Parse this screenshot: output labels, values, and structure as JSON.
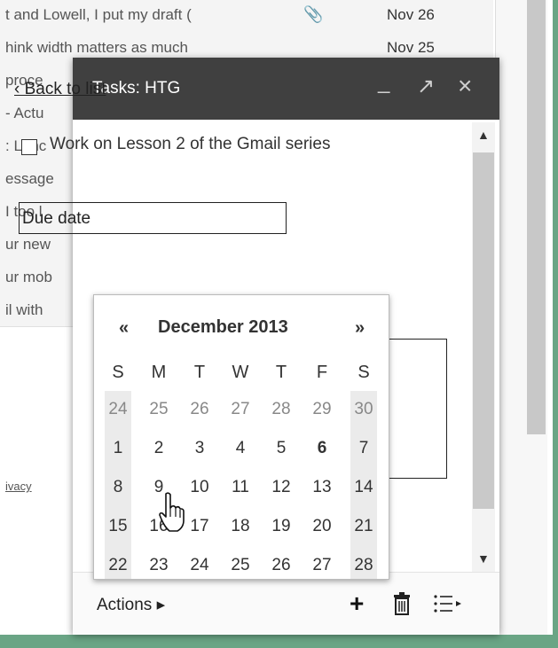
{
  "background": {
    "rows": [
      {
        "snippet": "t and Lowell, I put my draft (",
        "date": "Nov 26",
        "attachment": true
      },
      {
        "snippet": "hink width matters as much",
        "date": "Nov 25",
        "attachment": false
      },
      {
        "snippet": "proce",
        "date": "",
        "attachment": false
      },
      {
        "snippet": "- Actu",
        "date": "",
        "attachment": false
      },
      {
        "snippet": ": Lunc",
        "date": "",
        "attachment": false
      },
      {
        "snippet": "essage",
        "date": "",
        "attachment": false
      },
      {
        "snippet": "I too l",
        "date": "",
        "attachment": false
      },
      {
        "snippet": "ur new",
        "date": "",
        "attachment": false
      },
      {
        "snippet": "ur mob",
        "date": "",
        "attachment": false
      },
      {
        "snippet": "il with",
        "date": "",
        "attachment": false
      }
    ],
    "privacy_link": "ivacy"
  },
  "tasks_window": {
    "title": "Tasks: HTG",
    "minimize": "_",
    "popout": "↗",
    "close": "×",
    "back_link": "‹ Back to list",
    "task_text": "Work on Lesson 2 of the Gmail series",
    "due_value": "Due date",
    "actions_label": "Actions ▸",
    "add_icon": "plus-icon",
    "trash_icon": "trash-icon",
    "list_icon": "list-options-icon"
  },
  "calendar": {
    "prev": "«",
    "next": "»",
    "month_label": "December 2013",
    "weekday_headers": [
      "S",
      "M",
      "T",
      "W",
      "T",
      "F",
      "S"
    ],
    "weeks": [
      [
        "24",
        "25",
        "26",
        "27",
        "28",
        "29",
        "30"
      ],
      [
        "1",
        "2",
        "3",
        "4",
        "5",
        "6",
        "7"
      ],
      [
        "8",
        "9",
        "10",
        "11",
        "12",
        "13",
        "14"
      ],
      [
        "15",
        "16",
        "17",
        "18",
        "19",
        "20",
        "21"
      ],
      [
        "22",
        "23",
        "24",
        "25",
        "26",
        "27",
        "28"
      ]
    ],
    "today": "6"
  },
  "colors": {
    "titlebar": "#404040",
    "frame": "#6aa585"
  }
}
